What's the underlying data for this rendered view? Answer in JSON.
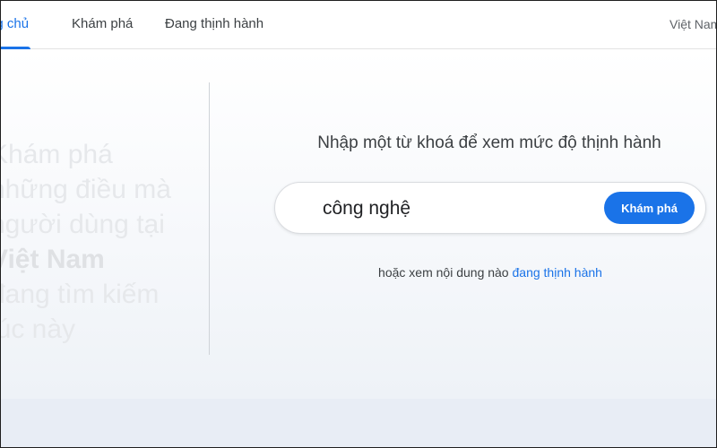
{
  "nav": {
    "tabs": [
      {
        "label": "ng chủ",
        "active": true
      },
      {
        "label": "Khám phá",
        "active": false
      },
      {
        "label": "Đang thịnh hành",
        "active": false
      }
    ],
    "region": "Việt Nam"
  },
  "hero": {
    "lines": [
      "Khám phá",
      "những điều mà",
      "người dùng tại",
      "Việt Nam",
      "đang tìm kiếm",
      "lúc này"
    ],
    "line1": "Khám phá",
    "line2": "những điều mà",
    "line3": "người dùng tại",
    "line4": "Việt Nam",
    "line5": "đang tìm kiếm",
    "line6": "lúc này"
  },
  "search": {
    "prompt": "Nhập một từ khoá để xem mức độ thịnh hành",
    "value": "công nghệ",
    "button_label": "Khám phá",
    "alt_text": "hoặc xem nội dung nào",
    "alt_link": "đang thịnh hành"
  },
  "colors": {
    "accent": "#1a73e8",
    "text": "#3c4043",
    "hero_faded": "#e6e8eb",
    "footer_band": "#e8edf5"
  }
}
